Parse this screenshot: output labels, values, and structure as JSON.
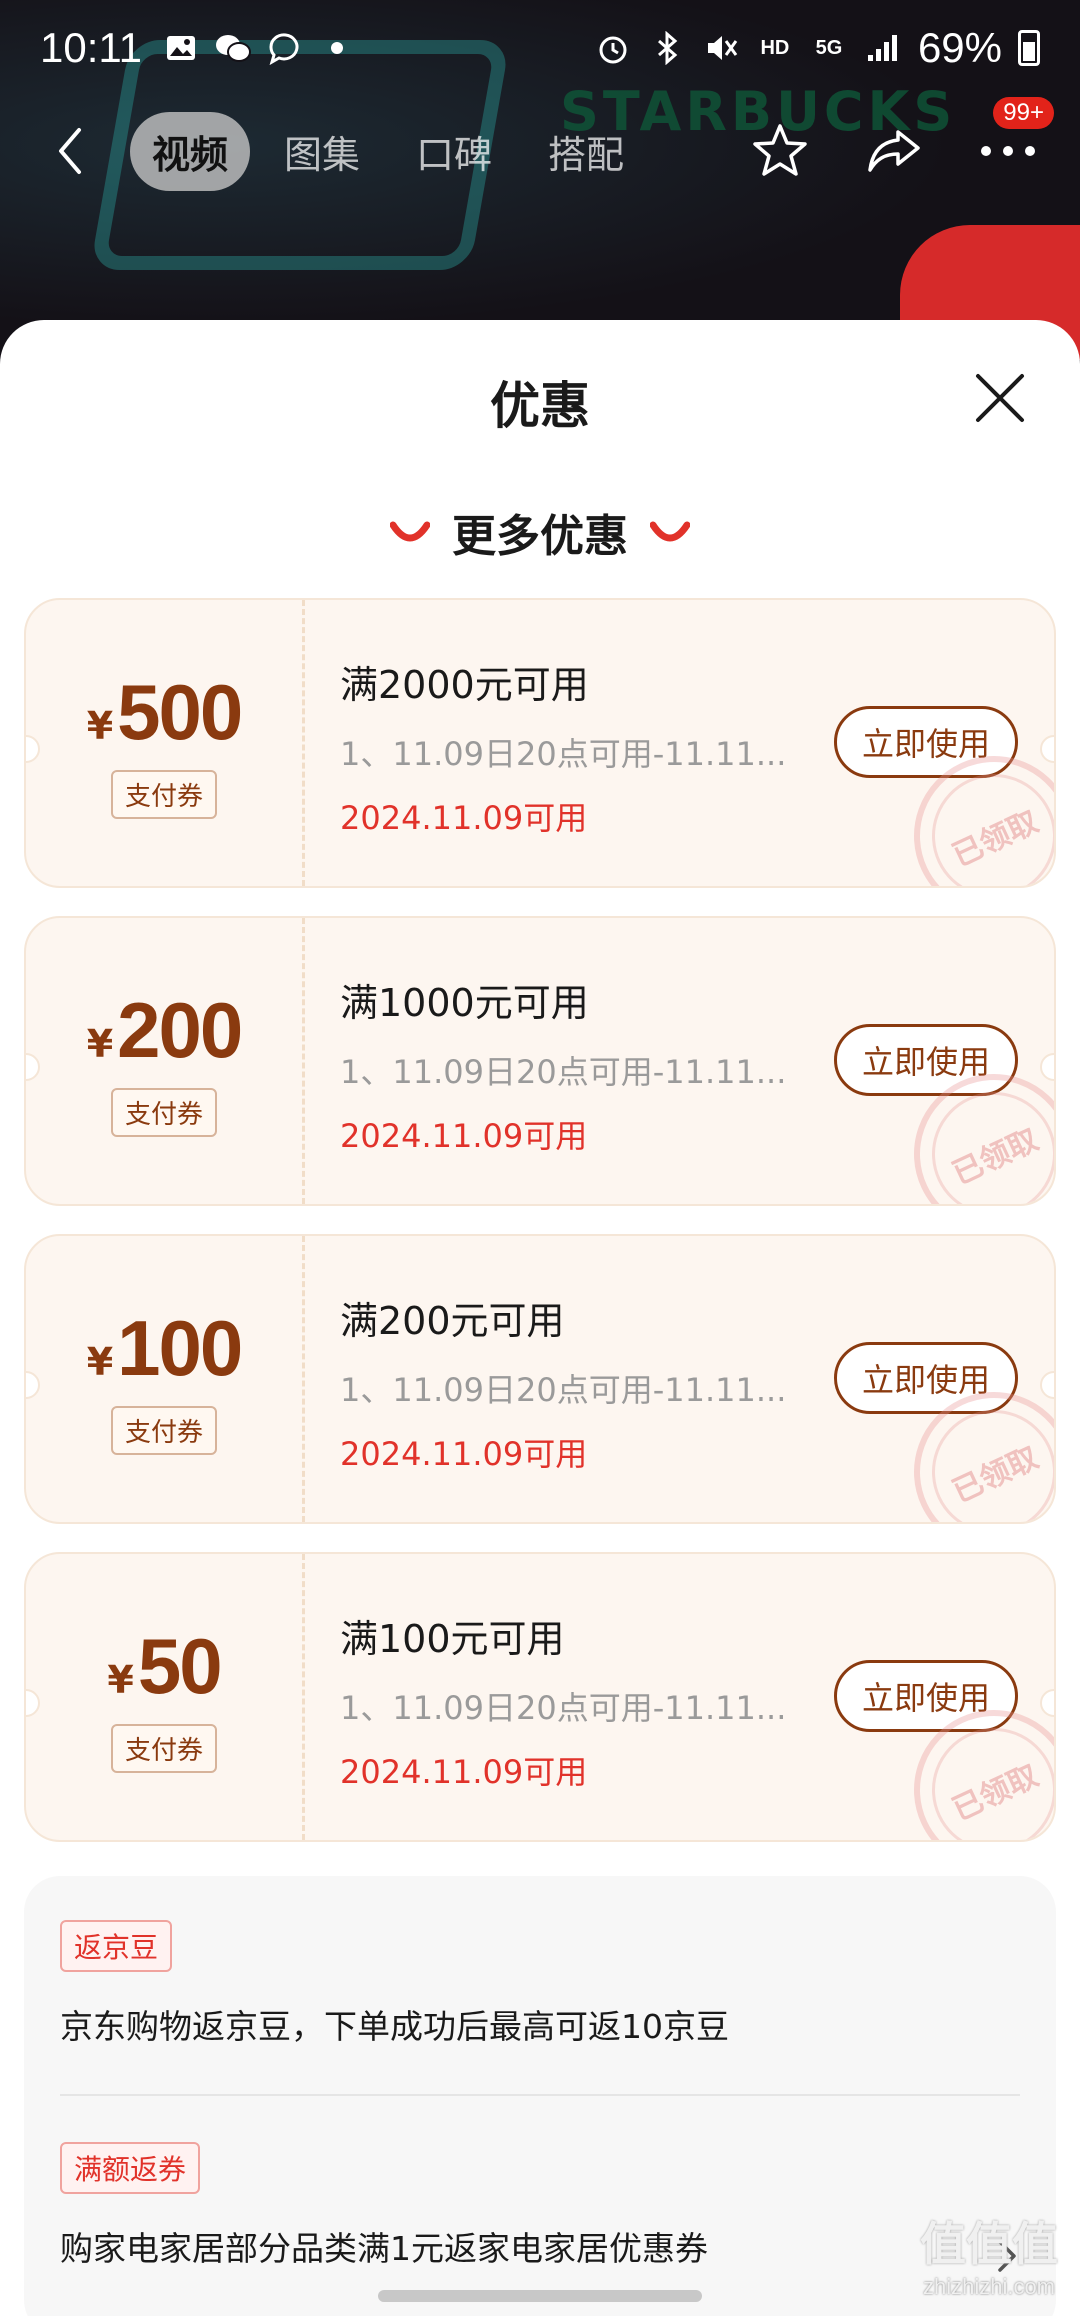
{
  "status_bar": {
    "time": "10:11",
    "battery": "69%",
    "icons": [
      "gallery-icon",
      "wechat-icon",
      "chat-bubble-icon",
      "dot-icon",
      "alarm-icon",
      "bluetooth-icon",
      "mute-icon",
      "hd-icon",
      "5g-icon",
      "signal-icon",
      "battery-icon"
    ]
  },
  "header": {
    "tabs": [
      {
        "label": "视频",
        "active": true
      },
      {
        "label": "图集",
        "active": false
      },
      {
        "label": "口碑",
        "active": false
      },
      {
        "label": "搭配",
        "active": false
      }
    ],
    "badge": "99+",
    "background_text": "STARBUCKS"
  },
  "sheet": {
    "title": "优惠",
    "section_title": "更多优惠"
  },
  "coupons": [
    {
      "currency": "¥",
      "amount": "500",
      "type": "支付券",
      "condition": "满2000元可用",
      "description": "1、11.09日20点可用-11.11...",
      "validity": "2024.11.09可用",
      "button": "立即使用",
      "stamp": "已领取"
    },
    {
      "currency": "¥",
      "amount": "200",
      "type": "支付券",
      "condition": "满1000元可用",
      "description": "1、11.09日20点可用-11.11...",
      "validity": "2024.11.09可用",
      "button": "立即使用",
      "stamp": "已领取"
    },
    {
      "currency": "¥",
      "amount": "100",
      "type": "支付券",
      "condition": "满200元可用",
      "description": "1、11.09日20点可用-11.11...",
      "validity": "2024.11.09可用",
      "button": "立即使用",
      "stamp": "已领取"
    },
    {
      "currency": "¥",
      "amount": "50",
      "type": "支付券",
      "condition": "满100元可用",
      "description": "1、11.09日20点可用-11.11...",
      "validity": "2024.11.09可用",
      "button": "立即使用",
      "stamp": "已领取"
    }
  ],
  "info": [
    {
      "tag": "返京豆",
      "text": "京东购物返京豆，下单成功后最高可返10京豆"
    },
    {
      "tag": "满额返券",
      "text": "购家电家居部分品类满1元返家电家居优惠券"
    }
  ],
  "watermark": {
    "logo": "值值值",
    "text": "zhizhizhi.com"
  },
  "colors": {
    "accent": "#e1322a",
    "coupon_brown": "#8a3a0f",
    "coupon_bg": "#fdf6f0"
  }
}
